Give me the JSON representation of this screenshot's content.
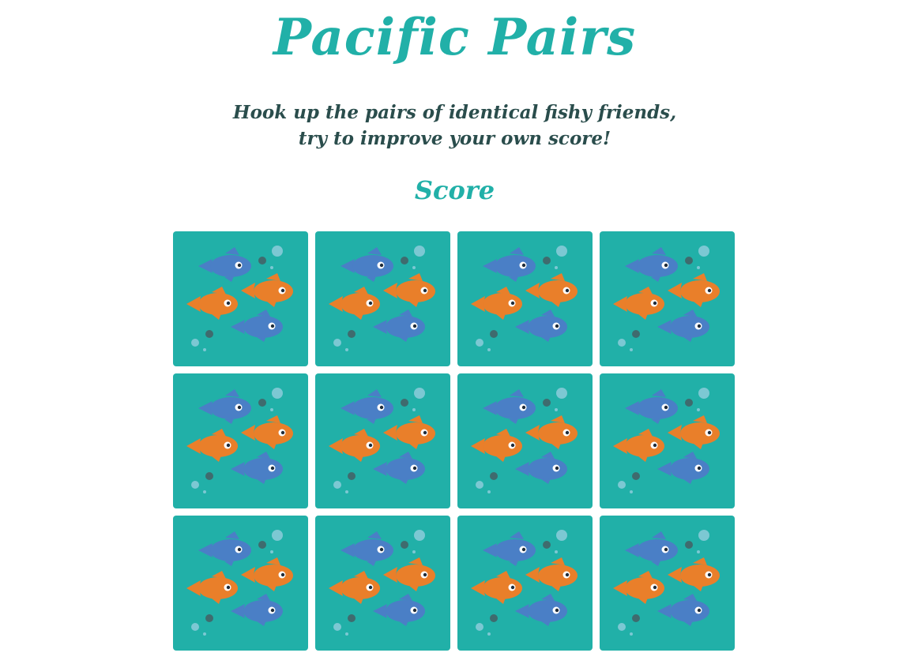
{
  "title": "Pacific Pairs",
  "tagline": {
    "line1": "Hook up the pairs of identical fishy friends,",
    "line2": "try to improve your own score!"
  },
  "score": {
    "label": "Score"
  },
  "colors": {
    "accent": "#21b0a8",
    "tagline_text": "#2a4d4c",
    "fish_blue": "#4a7fc6",
    "fish_orange": "#e97f2a",
    "bubble_light": "#7cc8d3",
    "bubble_dark": "#3f6b6e"
  },
  "board": {
    "rows": 3,
    "columns": 4,
    "cards": [
      {
        "face": "fish-card-back",
        "state": "face-down"
      },
      {
        "face": "fish-card-back",
        "state": "face-down"
      },
      {
        "face": "fish-card-back",
        "state": "face-down"
      },
      {
        "face": "fish-card-back",
        "state": "face-down"
      },
      {
        "face": "fish-card-back",
        "state": "face-down"
      },
      {
        "face": "fish-card-back",
        "state": "face-down"
      },
      {
        "face": "fish-card-back",
        "state": "face-down"
      },
      {
        "face": "fish-card-back",
        "state": "face-down"
      },
      {
        "face": "fish-card-back",
        "state": "face-down"
      },
      {
        "face": "fish-card-back",
        "state": "face-down"
      },
      {
        "face": "fish-card-back",
        "state": "face-down"
      },
      {
        "face": "fish-card-back",
        "state": "face-down"
      }
    ]
  }
}
